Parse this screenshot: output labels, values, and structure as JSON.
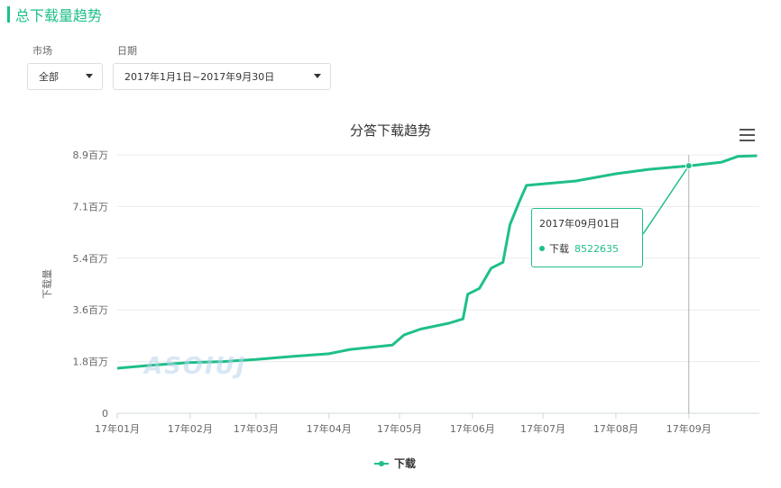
{
  "header": {
    "title": "总下载量趋势"
  },
  "filters": {
    "market_label": "市场",
    "market_value": "全部",
    "date_label": "日期",
    "date_value": "2017年1月1日~2017年9月30日"
  },
  "chart": {
    "menu_icon": "hamburger-menu-icon",
    "accent_color": "#1fbf8a",
    "watermark": "ASOIUJ",
    "tooltip": {
      "date": "2017年09月01日",
      "series": "下载",
      "value": "8522635"
    }
  },
  "chart_data": {
    "type": "line",
    "title": "分答下载趋势",
    "ylabel": "下载量",
    "xlabel": "",
    "ylim": [
      0,
      8900000
    ],
    "yticks": [
      0,
      1780000,
      3560000,
      5340000,
      7120000,
      8900000
    ],
    "ytick_labels": [
      "0",
      "1.8百万",
      "3.6百万",
      "5.4百万",
      "7.1百万",
      "8.9百万"
    ],
    "xtick_labels": [
      "17年01月",
      "17年02月",
      "17年03月",
      "17年04月",
      "17年05月",
      "17年06月",
      "17年07月",
      "17年08月",
      "17年09月"
    ],
    "xtick_dates": [
      "2017-01-01",
      "2017-02-01",
      "2017-03-01",
      "2017-04-01",
      "2017-05-01",
      "2017-06-01",
      "2017-07-01",
      "2017-08-01",
      "2017-09-01"
    ],
    "x_range": [
      "2017-01-01",
      "2017-09-30"
    ],
    "legend": "bottom-center",
    "grid": true,
    "series": [
      {
        "name": "下载",
        "color": "#1fbf8a",
        "points": [
          [
            "2017-01-01",
            1550000
          ],
          [
            "2017-01-15",
            1650000
          ],
          [
            "2017-02-01",
            1750000
          ],
          [
            "2017-02-15",
            1780000
          ],
          [
            "2017-03-01",
            1850000
          ],
          [
            "2017-03-15",
            1950000
          ],
          [
            "2017-04-01",
            2050000
          ],
          [
            "2017-04-10",
            2200000
          ],
          [
            "2017-04-28",
            2350000
          ],
          [
            "2017-05-03",
            2700000
          ],
          [
            "2017-05-10",
            2900000
          ],
          [
            "2017-05-22",
            3100000
          ],
          [
            "2017-05-28",
            3250000
          ],
          [
            "2017-05-30",
            4100000
          ],
          [
            "2017-06-04",
            4300000
          ],
          [
            "2017-06-09",
            5000000
          ],
          [
            "2017-06-14",
            5200000
          ],
          [
            "2017-06-17",
            6500000
          ],
          [
            "2017-06-21",
            7300000
          ],
          [
            "2017-06-24",
            7850000
          ],
          [
            "2017-07-01",
            7900000
          ],
          [
            "2017-07-15",
            8000000
          ],
          [
            "2017-08-01",
            8250000
          ],
          [
            "2017-08-15",
            8400000
          ],
          [
            "2017-09-01",
            8522635
          ],
          [
            "2017-09-15",
            8650000
          ],
          [
            "2017-09-22",
            8850000
          ],
          [
            "2017-09-30",
            8870000
          ]
        ]
      }
    ]
  }
}
